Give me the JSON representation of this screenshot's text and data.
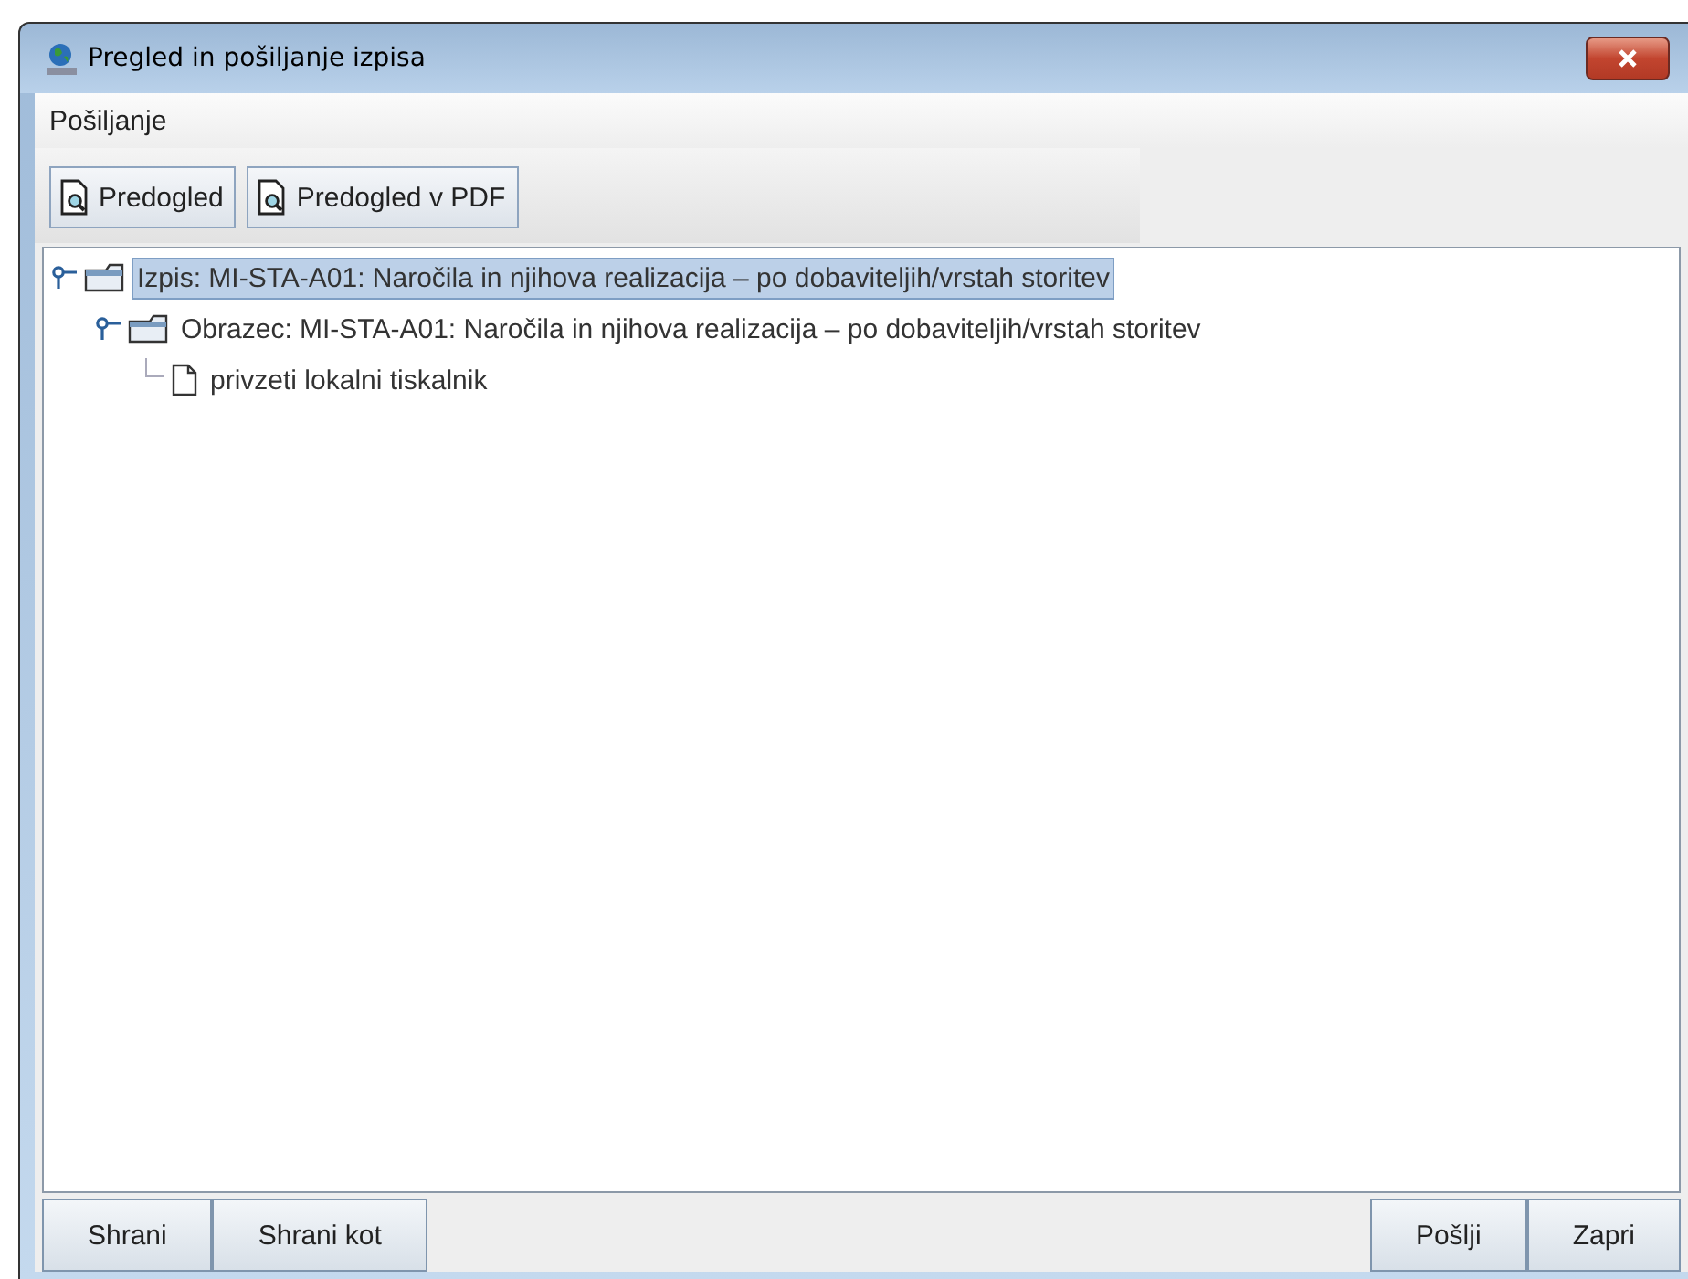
{
  "window": {
    "title": "Pregled in pošiljanje izpisa"
  },
  "menu": [
    {
      "label": "Pošiljanje"
    }
  ],
  "toolbar": [
    {
      "label": "Predogled"
    },
    {
      "label": "Predogled v PDF"
    }
  ],
  "tree": [
    {
      "kind": "folder",
      "label": "Izpis: MI-STA-A01: Naročila in njihova realizacija – po dobaviteljih/vrstah storitev",
      "selected": true,
      "expanded": true,
      "children": [
        {
          "kind": "folder",
          "label": "Obrazec: MI-STA-A01: Naročila in njihova realizacija – po dobaviteljih/vrstah storitev",
          "selected": false,
          "expanded": true,
          "children": [
            {
              "kind": "document",
              "label": "privzeti lokalni tiskalnik",
              "selected": false
            }
          ]
        }
      ]
    }
  ],
  "buttons_left": [
    "Shrani",
    "Shrani kot"
  ],
  "buttons_right": [
    "Pošlji",
    "Zapri"
  ]
}
